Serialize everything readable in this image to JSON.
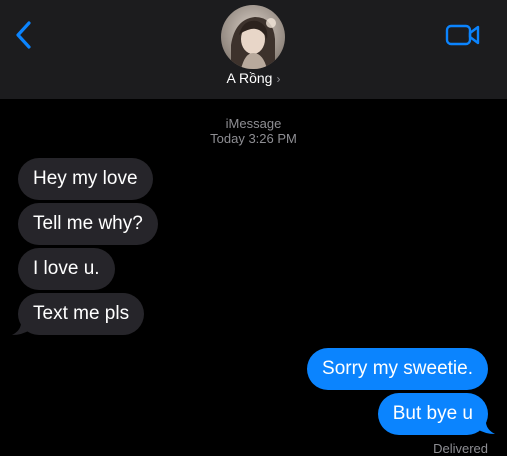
{
  "header": {
    "contact_name": "A Rồng",
    "name_chevron": "›",
    "back_icon": "chevron-left-icon",
    "video_icon": "video-camera-icon",
    "accent_color": "#0b84fe"
  },
  "thread": {
    "service": "iMessage",
    "timestamp": "Today 3:26 PM",
    "incoming": [
      {
        "text": "Hey my love"
      },
      {
        "text": "Tell me why?"
      },
      {
        "text": "I love u."
      },
      {
        "text": "Text me pls"
      }
    ],
    "outgoing": [
      {
        "text": "Sorry my sweetie."
      },
      {
        "text": "But bye u"
      }
    ],
    "status": "Delivered"
  },
  "colors": {
    "incoming_bubble": "#26252a",
    "outgoing_bubble": "#0b84fe",
    "background": "#000000",
    "header_background": "#1c1c1e"
  }
}
